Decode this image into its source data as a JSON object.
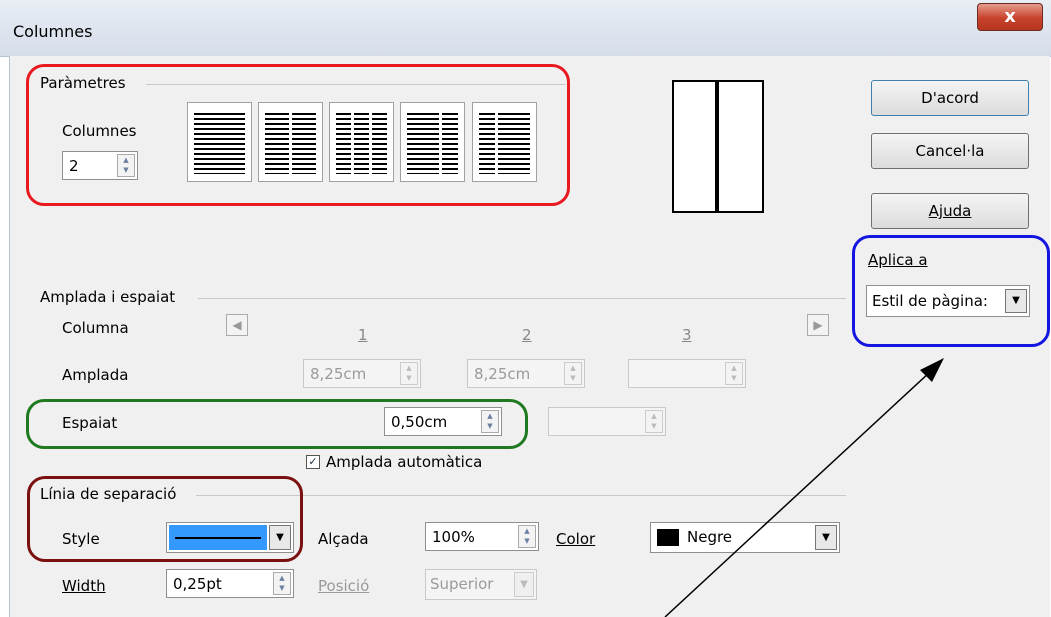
{
  "window": {
    "title": "Columnes",
    "close_label": "x"
  },
  "params": {
    "group_title": "Paràmetres",
    "columns_label": "Columnes",
    "columns_value": "2",
    "layouts": [
      "1 columna",
      "2 columnes",
      "3 columnes",
      "2 columnes esquerra",
      "2 columnes dreta"
    ]
  },
  "buttons": {
    "ok": "D'acord",
    "cancel": "Cancel·la",
    "help": "Ajuda"
  },
  "apply": {
    "label": "Aplica a",
    "value": "Estil de pàgina:"
  },
  "width_spacing": {
    "group_title": "Amplada i espaiat",
    "column_label": "Columna",
    "col_numbers": [
      "1",
      "2",
      "3"
    ],
    "width_label": "Amplada",
    "width_values": [
      "8,25cm",
      "8,25cm",
      ""
    ],
    "spacing_label": "Espaiat",
    "spacing_values": [
      "0,50cm",
      ""
    ],
    "autowidth_label": "Amplada automàtica",
    "autowidth_checked": true
  },
  "separator": {
    "group_title": "Línia de separació",
    "style_label": "Style",
    "height_label": "Alçada",
    "height_value": "100%",
    "color_label": "Color",
    "color_value": "Negre",
    "width_label": "Width",
    "width_value": "0,25pt",
    "position_label": "Posició",
    "position_value": "Superior"
  },
  "colors": {
    "red": "#e8191f",
    "blue": "#1515e0",
    "green": "#1f7a1f",
    "maroon": "#7a1010"
  }
}
